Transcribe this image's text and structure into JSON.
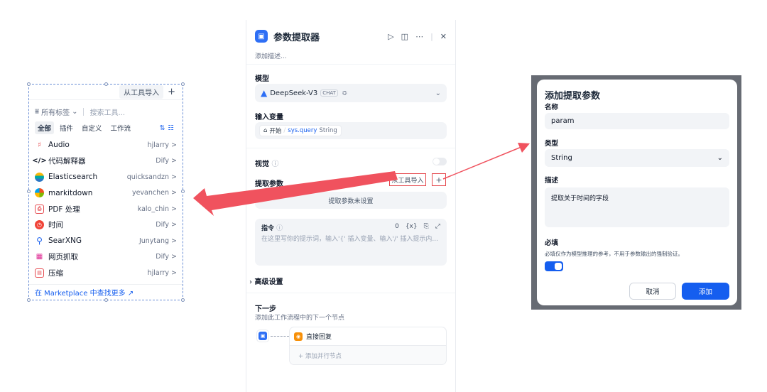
{
  "left_panel": {
    "import_label": "从工具导入",
    "add_label": "+",
    "tags_filter": "所有标签",
    "search_placeholder": "搜索工具...",
    "tabs": [
      "全部",
      "插件",
      "自定义",
      "工作流"
    ],
    "tools": [
      {
        "name": "Audio",
        "author": "hjlarry >",
        "icon_color": "#e5484d"
      },
      {
        "name": "代码解释器",
        "author": "Dify >",
        "icon_color": "#101828"
      },
      {
        "name": "Elasticsearch",
        "author": "quicksandzn >",
        "icon_color": "#00a9a5"
      },
      {
        "name": "markitdown",
        "author": "yevanchen >",
        "icon_color": "#f79009"
      },
      {
        "name": "PDF 处理",
        "author": "kalo_chin >",
        "icon_color": "#e5484d"
      },
      {
        "name": "时间",
        "author": "Dify >",
        "icon_color": "#e5484d"
      },
      {
        "name": "SearXNG",
        "author": "Junytang >",
        "icon_color": "#155eef"
      },
      {
        "name": "网页抓取",
        "author": "Dify >",
        "icon_color": "#dd2590"
      },
      {
        "name": "压缩",
        "author": "hjlarry >",
        "icon_color": "#e5484d"
      }
    ],
    "footer_link": "在 Marketplace 中查找更多 ↗"
  },
  "center_panel": {
    "title": "参数提取器",
    "description_placeholder": "添加描述...",
    "model_section": "模型",
    "model_name": "DeepSeek-V3",
    "model_badge": "CHAT",
    "input_var_section": "输入变量",
    "input_var_source": "开始",
    "input_var_sep": "/",
    "input_var_name": "sys.query",
    "input_var_type": "String",
    "vision_label": "视觉",
    "extract_params_label": "提取参数",
    "import_from_tool": "从工具导入",
    "add_symbol": "+",
    "params_empty": "提取参数未设置",
    "instruction_label": "指令",
    "instruction_count": "0",
    "instruction_var": "{x}",
    "instruction_placeholder": "在这里写你的提示词，输入'{' 插入变量、输入'/' 插入提示内...",
    "advanced_label": "高级设置",
    "next_step_title": "下一步",
    "next_step_desc": "添加此工作流程中的下一个节点",
    "next_node_name": "直接回复",
    "add_parallel": "+ 添加并行节点"
  },
  "dialog": {
    "title": "添加提取参数",
    "name_label": "名称",
    "name_value": "param",
    "type_label": "类型",
    "type_value": "String",
    "desc_label": "描述",
    "desc_value": "提取关于时间的字段",
    "required_label": "必填",
    "required_hint": "必填仅作为模型推理的参考，不用于参数输出的强制验证。",
    "required_on": true,
    "cancel_label": "取消",
    "add_label": "添加"
  },
  "colors": {
    "accent": "#155eef",
    "arrow": "#f0525e",
    "highlight": "#e5484d"
  }
}
